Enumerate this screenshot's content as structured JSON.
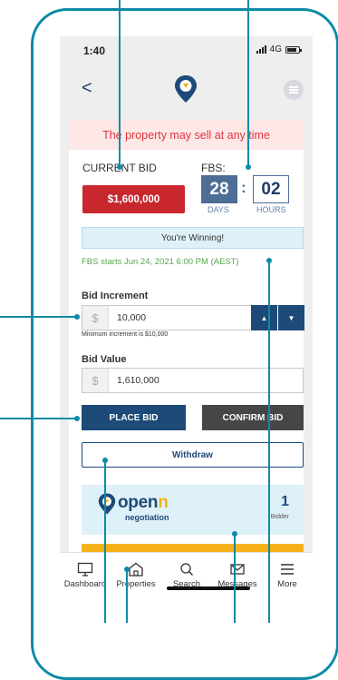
{
  "status_bar": {
    "time": "1:40",
    "network": "4G"
  },
  "header": {
    "back_label": "<"
  },
  "auction": {
    "warning": "The property may sell at any time",
    "current_bid_label": "CURRENT BID",
    "current_bid_value": "$1,600,000",
    "fbs_label": "FBS:",
    "fbs_days": "28",
    "fbs_hours": "02",
    "days_label": "DAYS",
    "hours_label": "HOURS",
    "status_message": "You're Winning!",
    "fbs_start": "FBS starts Jun 24, 2021 6:00 PM (AEST)"
  },
  "bid_increment": {
    "label": "Bid Increment",
    "currency": "$",
    "value": "10,000",
    "hint": "Minimum increment is $10,000"
  },
  "bid_value": {
    "label": "Bid Value",
    "currency": "$",
    "value": "1,610,000"
  },
  "actions": {
    "place_bid": "PLACE BID",
    "confirm_bid": "CONFIRM BID",
    "withdraw": "Withdraw"
  },
  "promo": {
    "brand": "openn",
    "brand_sub": "negotiation",
    "bidder_count": "1",
    "bidder_label": "Bidder"
  },
  "tabbar": {
    "items": [
      {
        "label": "Dashboard",
        "icon": "monitor-icon"
      },
      {
        "label": "Properties",
        "icon": "home-icon"
      },
      {
        "label": "Search",
        "icon": "search-icon"
      },
      {
        "label": "Messages",
        "icon": "mail-icon"
      },
      {
        "label": "More",
        "icon": "menu-icon"
      }
    ]
  },
  "colors": {
    "accent": "#0e8aa6",
    "brand_navy": "#1d4a78",
    "brand_gold": "#f5b21b",
    "alert_red": "#c8272d",
    "success_green": "#53a84a"
  }
}
